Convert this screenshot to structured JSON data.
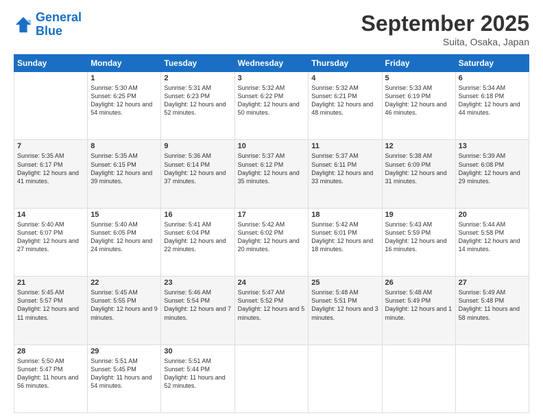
{
  "logo": {
    "line1": "General",
    "line2": "Blue"
  },
  "header": {
    "month": "September 2025",
    "location": "Suita, Osaka, Japan"
  },
  "weekdays": [
    "Sunday",
    "Monday",
    "Tuesday",
    "Wednesday",
    "Thursday",
    "Friday",
    "Saturday"
  ],
  "weeks": [
    [
      {
        "day": "",
        "sunrise": "",
        "sunset": "",
        "daylight": ""
      },
      {
        "day": "1",
        "sunrise": "Sunrise: 5:30 AM",
        "sunset": "Sunset: 6:25 PM",
        "daylight": "Daylight: 12 hours and 54 minutes."
      },
      {
        "day": "2",
        "sunrise": "Sunrise: 5:31 AM",
        "sunset": "Sunset: 6:23 PM",
        "daylight": "Daylight: 12 hours and 52 minutes."
      },
      {
        "day": "3",
        "sunrise": "Sunrise: 5:32 AM",
        "sunset": "Sunset: 6:22 PM",
        "daylight": "Daylight: 12 hours and 50 minutes."
      },
      {
        "day": "4",
        "sunrise": "Sunrise: 5:32 AM",
        "sunset": "Sunset: 6:21 PM",
        "daylight": "Daylight: 12 hours and 48 minutes."
      },
      {
        "day": "5",
        "sunrise": "Sunrise: 5:33 AM",
        "sunset": "Sunset: 6:19 PM",
        "daylight": "Daylight: 12 hours and 46 minutes."
      },
      {
        "day": "6",
        "sunrise": "Sunrise: 5:34 AM",
        "sunset": "Sunset: 6:18 PM",
        "daylight": "Daylight: 12 hours and 44 minutes."
      }
    ],
    [
      {
        "day": "7",
        "sunrise": "Sunrise: 5:35 AM",
        "sunset": "Sunset: 6:17 PM",
        "daylight": "Daylight: 12 hours and 41 minutes."
      },
      {
        "day": "8",
        "sunrise": "Sunrise: 5:35 AM",
        "sunset": "Sunset: 6:15 PM",
        "daylight": "Daylight: 12 hours and 39 minutes."
      },
      {
        "day": "9",
        "sunrise": "Sunrise: 5:36 AM",
        "sunset": "Sunset: 6:14 PM",
        "daylight": "Daylight: 12 hours and 37 minutes."
      },
      {
        "day": "10",
        "sunrise": "Sunrise: 5:37 AM",
        "sunset": "Sunset: 6:12 PM",
        "daylight": "Daylight: 12 hours and 35 minutes."
      },
      {
        "day": "11",
        "sunrise": "Sunrise: 5:37 AM",
        "sunset": "Sunset: 6:11 PM",
        "daylight": "Daylight: 12 hours and 33 minutes."
      },
      {
        "day": "12",
        "sunrise": "Sunrise: 5:38 AM",
        "sunset": "Sunset: 6:09 PM",
        "daylight": "Daylight: 12 hours and 31 minutes."
      },
      {
        "day": "13",
        "sunrise": "Sunrise: 5:39 AM",
        "sunset": "Sunset: 6:08 PM",
        "daylight": "Daylight: 12 hours and 29 minutes."
      }
    ],
    [
      {
        "day": "14",
        "sunrise": "Sunrise: 5:40 AM",
        "sunset": "Sunset: 6:07 PM",
        "daylight": "Daylight: 12 hours and 27 minutes."
      },
      {
        "day": "15",
        "sunrise": "Sunrise: 5:40 AM",
        "sunset": "Sunset: 6:05 PM",
        "daylight": "Daylight: 12 hours and 24 minutes."
      },
      {
        "day": "16",
        "sunrise": "Sunrise: 5:41 AM",
        "sunset": "Sunset: 6:04 PM",
        "daylight": "Daylight: 12 hours and 22 minutes."
      },
      {
        "day": "17",
        "sunrise": "Sunrise: 5:42 AM",
        "sunset": "Sunset: 6:02 PM",
        "daylight": "Daylight: 12 hours and 20 minutes."
      },
      {
        "day": "18",
        "sunrise": "Sunrise: 5:42 AM",
        "sunset": "Sunset: 6:01 PM",
        "daylight": "Daylight: 12 hours and 18 minutes."
      },
      {
        "day": "19",
        "sunrise": "Sunrise: 5:43 AM",
        "sunset": "Sunset: 5:59 PM",
        "daylight": "Daylight: 12 hours and 16 minutes."
      },
      {
        "day": "20",
        "sunrise": "Sunrise: 5:44 AM",
        "sunset": "Sunset: 5:58 PM",
        "daylight": "Daylight: 12 hours and 14 minutes."
      }
    ],
    [
      {
        "day": "21",
        "sunrise": "Sunrise: 5:45 AM",
        "sunset": "Sunset: 5:57 PM",
        "daylight": "Daylight: 12 hours and 11 minutes."
      },
      {
        "day": "22",
        "sunrise": "Sunrise: 5:45 AM",
        "sunset": "Sunset: 5:55 PM",
        "daylight": "Daylight: 12 hours and 9 minutes."
      },
      {
        "day": "23",
        "sunrise": "Sunrise: 5:46 AM",
        "sunset": "Sunset: 5:54 PM",
        "daylight": "Daylight: 12 hours and 7 minutes."
      },
      {
        "day": "24",
        "sunrise": "Sunrise: 5:47 AM",
        "sunset": "Sunset: 5:52 PM",
        "daylight": "Daylight: 12 hours and 5 minutes."
      },
      {
        "day": "25",
        "sunrise": "Sunrise: 5:48 AM",
        "sunset": "Sunset: 5:51 PM",
        "daylight": "Daylight: 12 hours and 3 minutes."
      },
      {
        "day": "26",
        "sunrise": "Sunrise: 5:48 AM",
        "sunset": "Sunset: 5:49 PM",
        "daylight": "Daylight: 12 hours and 1 minute."
      },
      {
        "day": "27",
        "sunrise": "Sunrise: 5:49 AM",
        "sunset": "Sunset: 5:48 PM",
        "daylight": "Daylight: 11 hours and 58 minutes."
      }
    ],
    [
      {
        "day": "28",
        "sunrise": "Sunrise: 5:50 AM",
        "sunset": "Sunset: 5:47 PM",
        "daylight": "Daylight: 11 hours and 56 minutes."
      },
      {
        "day": "29",
        "sunrise": "Sunrise: 5:51 AM",
        "sunset": "Sunset: 5:45 PM",
        "daylight": "Daylight: 11 hours and 54 minutes."
      },
      {
        "day": "30",
        "sunrise": "Sunrise: 5:51 AM",
        "sunset": "Sunset: 5:44 PM",
        "daylight": "Daylight: 11 hours and 52 minutes."
      },
      {
        "day": "",
        "sunrise": "",
        "sunset": "",
        "daylight": ""
      },
      {
        "day": "",
        "sunrise": "",
        "sunset": "",
        "daylight": ""
      },
      {
        "day": "",
        "sunrise": "",
        "sunset": "",
        "daylight": ""
      },
      {
        "day": "",
        "sunrise": "",
        "sunset": "",
        "daylight": ""
      }
    ]
  ]
}
